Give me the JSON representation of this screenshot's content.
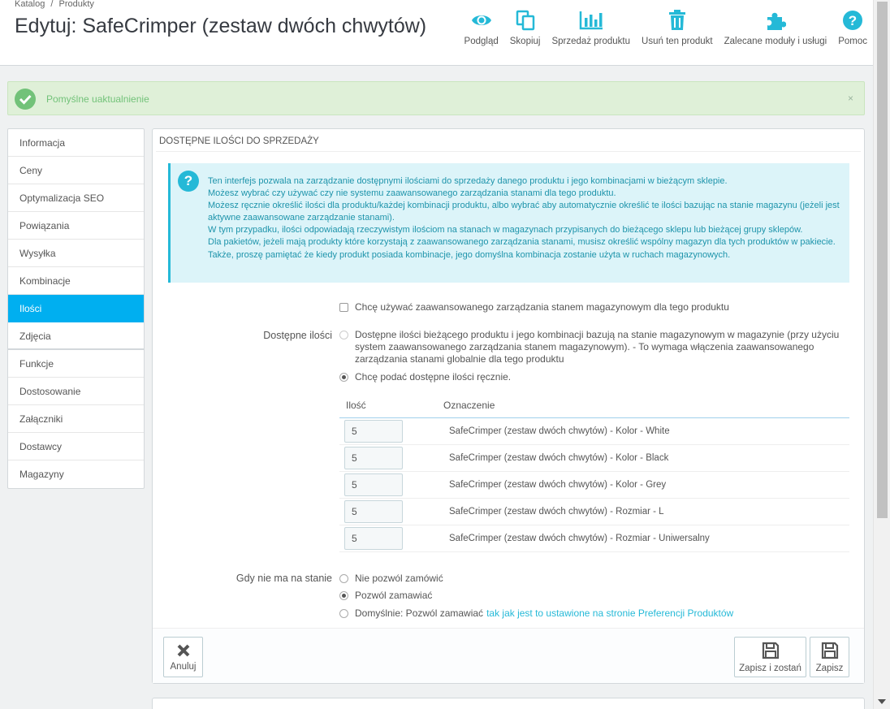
{
  "header": {
    "breadcrumb": [
      "Katalog",
      "/",
      "Produkty"
    ],
    "title": "Edytuj: SafeCrimper (zestaw dwóch chwytów)",
    "toolbar": [
      {
        "label": "Podgląd",
        "icon": "eye-icon"
      },
      {
        "label": "Skopiuj",
        "icon": "copy-icon"
      },
      {
        "label": "Sprzedaż produktu",
        "icon": "bar-chart-icon"
      },
      {
        "label": "Usuń ten produkt",
        "icon": "trash-icon"
      },
      {
        "label": "Zalecane moduły i usługi",
        "icon": "puzzle-icon"
      },
      {
        "label": "Pomoc",
        "icon": "help-icon"
      }
    ]
  },
  "alert": {
    "message": "Pomyślne uaktualnienie",
    "close": "×"
  },
  "sidebar": {
    "items": [
      {
        "label": "Informacja"
      },
      {
        "label": "Ceny"
      },
      {
        "label": "Optymalizacja SEO"
      },
      {
        "label": "Powiązania"
      },
      {
        "label": "Wysyłka"
      },
      {
        "label": "Kombinacje"
      },
      {
        "label": "Ilości",
        "active": true
      },
      {
        "label": "Zdjęcia"
      },
      {
        "label": "Funkcje"
      },
      {
        "label": "Dostosowanie"
      },
      {
        "label": "Załączniki"
      },
      {
        "label": "Dostawcy"
      },
      {
        "label": "Magazyny"
      }
    ]
  },
  "panel": {
    "heading": "Dostępne ilości do sprzedaży",
    "info": [
      "Ten interfejs pozwala na zarządzanie dostępnymi ilościami do sprzedaży danego produktu i jego kombinacjami w bieżącym sklepie.",
      "Możesz wybrać czy używać czy nie systemu zaawansowanego zarządzania stanami dla tego produktu.",
      "Możesz ręcznie określić ilości dla produktu/każdej kombinacji produktu, albo wybrać aby automatycznie określić te ilości bazując na stanie magazynu (jeżeli jest aktywne zaawansowane zarządzanie stanami).",
      "W tym przypadku, ilości odpowiadają rzeczywistym ilościom na stanach w magazynach przypisanych do bieżącego sklepu lub bieżącej grupy sklepów.",
      "Dla pakietów, jeżeli mają produkty które korzystają z zaawansowanego zarządzania stanami, musisz określić wspólny magazyn dla tych produktów w pakiecie.",
      "Także, proszę pamiętać że kiedy produkt posiada kombinacje, jego domyślna kombinacja zostanie użyta w ruchach magazynowych."
    ],
    "advanced_stock_checkbox": "Chcę używać zaawansowanego zarządzania stanem magazynowym dla tego produktu",
    "available_label": "Dostępne ilości",
    "available_options": [
      "Dostępne ilości bieżącego produktu i jego kombinacji bazują na stanie magazynowym w magazynie (przy użyciu system zaawansowanego zarządzania stanem magazynowym).  - To wymaga włączenia zaawansowanego zarządzania stanami globalnie dla tego produktu",
      "Chcę podać dostępne ilości ręcznie."
    ],
    "table": {
      "col_qty": "Ilość",
      "col_name": "Oznaczenie",
      "rows": [
        {
          "qty": "5",
          "name": "SafeCrimper (zestaw dwóch chwytów) - Kolor - White"
        },
        {
          "qty": "5",
          "name": "SafeCrimper (zestaw dwóch chwytów) - Kolor - Black"
        },
        {
          "qty": "5",
          "name": "SafeCrimper (zestaw dwóch chwytów) - Kolor - Grey"
        },
        {
          "qty": "5",
          "name": "SafeCrimper (zestaw dwóch chwytów) - Rozmiar - L"
        },
        {
          "qty": "5",
          "name": "SafeCrimper (zestaw dwóch chwytów) - Rozmiar - Uniwersalny"
        }
      ]
    },
    "oos_label": "Gdy nie ma na stanie",
    "oos_options": {
      "deny": "Nie pozwól zamówić",
      "allow": "Pozwól zamawiać",
      "default_prefix": "Domyślnie: Pozwól zamawiać",
      "default_link": "tak jak jest to ustawione na stronie Preferencji Produktów"
    },
    "footer": {
      "cancel": "Anuluj",
      "save_stay": "Zapisz i zostań",
      "save": "Zapisz"
    }
  },
  "colors": {
    "accent": "#00aff0",
    "success": "#72c279",
    "info": "#25b9d7",
    "link": "#25b9d7"
  }
}
